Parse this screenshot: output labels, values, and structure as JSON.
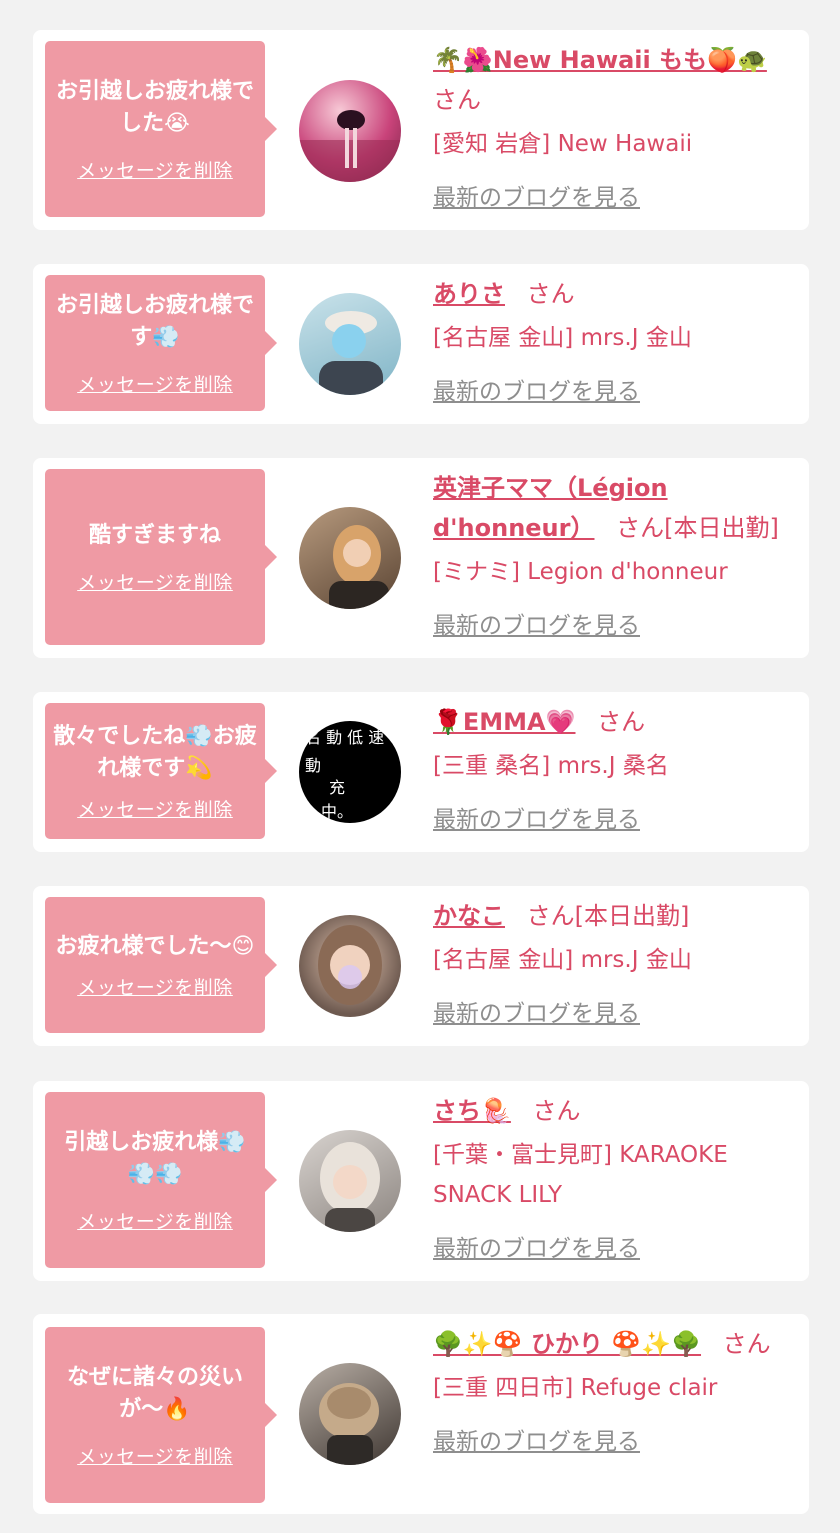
{
  "common": {
    "delete_label": "メッセージを削除",
    "blog_label": "最新のブログを見る",
    "san": "さん"
  },
  "messages": [
    {
      "message": "お引越しお疲れ様でした😭",
      "name": "🌴🌺New Hawaii もも🍑🐢",
      "suffix": "",
      "shop": "[愛知 岩倉] New Hawaii"
    },
    {
      "message": "お引越しお疲れ様です💨",
      "name": "ありさ",
      "suffix": "",
      "shop": "[名古屋 金山] mrs.J 金山"
    },
    {
      "message": "酷すぎますね",
      "name": "英津子ママ（Légion d'honneur）",
      "suffix": "[本日出勤]",
      "shop": "[ミナミ] Legion d'honneur"
    },
    {
      "message": "散々でしたね💨お疲れ様です💫",
      "name": "🌹EMMA💗",
      "suffix": "",
      "shop": "[三重 桑名] mrs.J 桑名"
    },
    {
      "message": "お疲れ様でした〜😊",
      "name": "かなこ",
      "suffix": "[本日出勤]",
      "shop": "[名古屋 金山] mrs.J 金山"
    },
    {
      "message": "引越しお疲れ様💨💨💨",
      "name": "さち🪼",
      "suffix": "",
      "shop": "[千葉・富士見町] KARAOKE SNACK LILY"
    },
    {
      "message": "なぜに諸々の災いが〜🔥",
      "name": "🌳✨🍄 ひかり 🍄✨🌳",
      "suffix": "",
      "shop": "[三重 四日市] Refuge clair"
    }
  ],
  "colors": {
    "bubble": "#ef9aa4",
    "accent": "#d94a66",
    "muted": "#8e8e8e",
    "background": "#f2f2f2"
  }
}
